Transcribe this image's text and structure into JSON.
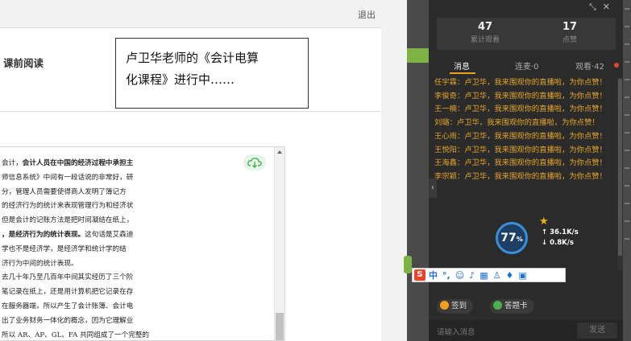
{
  "topbar": {
    "logout_label": "退出"
  },
  "course": {
    "section_title": "课前阅读"
  },
  "overlay": {
    "line1": "卢卫华老师的《会计电算",
    "line2": "化课程》进行中……"
  },
  "reader": {
    "lines": [
      {
        "a": "会计，",
        "b": "会计人员在中国的经济过程中承担主"
      },
      {
        "a": "师信息系统》中间有一段话说的非常好，研",
        "b": ""
      },
      {
        "a": "分，管理人员需要使得商人发明了簿记方",
        "b": ""
      },
      {
        "a": "的经济行为的统计来表现管理行为和经济状",
        "b": ""
      },
      {
        "a": "但是会计的记账方法是把时间凝结在纸上，",
        "b": ""
      },
      {
        "a": "，",
        "b": "是经济行为的统计表现。",
        "c": "这句话是艾森迪"
      },
      {
        "a": "学也不是经济学，是经济学和统计学的结",
        "b": ""
      },
      {
        "a": "济行为中间的统计表现。",
        "b": ""
      },
      {
        "a": "去几十年乃至几百年中间其实经历了三个阶",
        "b": ""
      },
      {
        "a": "笔记录在纸上，还是用计算机把它记录在存",
        "b": ""
      },
      {
        "a": "在服务器端，所以产生了会计账簿、会计电",
        "b": ""
      },
      {
        "a": "出了业务财务一体化的概念，因为它理解业",
        "b": ""
      },
      {
        "a": "所以 AR、AP、GL、FA 共同组成了一个完整的",
        "b": ""
      }
    ]
  },
  "panel": {
    "stats": [
      {
        "value": "47",
        "label": "累计观看"
      },
      {
        "value": "17",
        "label": "点赞"
      }
    ],
    "tabs": [
      {
        "label": "消息"
      },
      {
        "label": "连麦·0"
      },
      {
        "label": "观看·42"
      }
    ],
    "messages": [
      "任宇霖：卢卫华，我来围观你的直播啦，为你点赞！",
      "李俊奇：卢卫华，我来围观你的直播啦，为你点赞！",
      "王一楠：卢卫华，我来围观你的直播啦，为你点赞！",
      "刘璐：卢卫华，我来围观你的直播啦，为你点赞！",
      "王心雨：卢卫华，我来围观你的直播啦，为你点赞！",
      "王悦阳：卢卫华，我来围观你的直播啦，为你点赞！",
      "王海鑫：卢卫华，我来围观你的直播啦，为你点赞！",
      "李宗颖：卢卫华，我来围观你的直播啦，为你点赞！"
    ],
    "checkin_label": "签到",
    "answer_card_label": "答题卡",
    "input_placeholder": "请输入消息",
    "send_label": "发送"
  },
  "network": {
    "percent": "77",
    "percent_unit": "%",
    "upload": "36.1K/s",
    "download": "0.8K/s"
  },
  "ime": {
    "mode": "中",
    "punct": "°,"
  },
  "colors": {
    "message": "#e5a52b",
    "accent": "#f0a020",
    "green": "#7cb342"
  }
}
